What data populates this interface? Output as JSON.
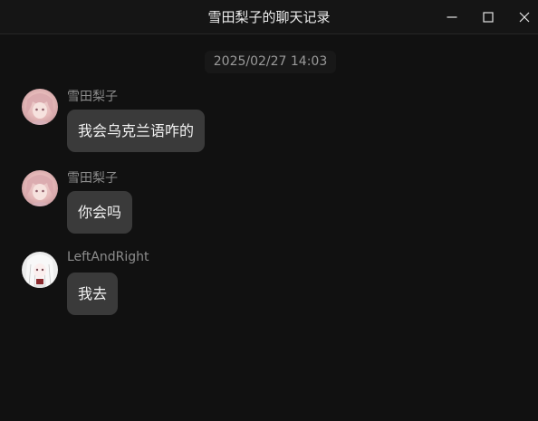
{
  "window": {
    "title": "雪田梨子的聊天记录"
  },
  "timestamp": "2025/02/27 14:03",
  "messages": [
    {
      "sender": "雪田梨子",
      "text": "我会乌克兰语咋的",
      "avatar": "anime-avatar-pink"
    },
    {
      "sender": "雪田梨子",
      "text": "你会吗",
      "avatar": "anime-avatar-pink"
    },
    {
      "sender": "LeftAndRight",
      "text": "我去",
      "avatar": "anime-avatar-white"
    }
  ],
  "colors": {
    "background": "#111111",
    "bubble": "#3a3a3a",
    "sender_text": "#8c8c8c",
    "title_text": "#ececec"
  },
  "icons": {
    "minimize": "minimize-icon",
    "maximize": "maximize-icon",
    "close": "close-icon"
  }
}
